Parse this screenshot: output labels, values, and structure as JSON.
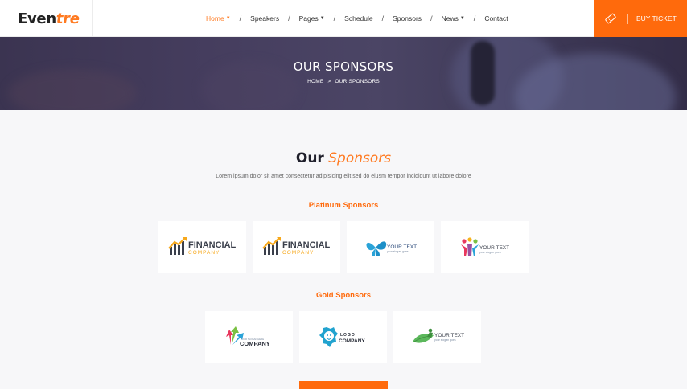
{
  "header": {
    "logo": {
      "part1": "Even",
      "part2": "tre"
    },
    "nav": [
      {
        "label": "Home",
        "dropdown": true,
        "active": true
      },
      {
        "label": "Speakers",
        "dropdown": false,
        "active": false
      },
      {
        "label": "Pages",
        "dropdown": true,
        "active": false
      },
      {
        "label": "Schedule",
        "dropdown": false,
        "active": false
      },
      {
        "label": "Sponsors",
        "dropdown": false,
        "active": false
      },
      {
        "label": "News",
        "dropdown": true,
        "active": false
      },
      {
        "label": "Contact",
        "dropdown": false,
        "active": false
      }
    ],
    "buy_ticket_label": "BUY TICKET",
    "ticket_icon": "ticket-icon"
  },
  "hero": {
    "title": "OUR SPONSORS",
    "breadcrumb": {
      "home": "HOME",
      "separator": ">",
      "current": "OUR SPONSORS"
    }
  },
  "section": {
    "title_dark": "Our",
    "title_accent": "Sponsors",
    "subtitle": "Lorem ipsum dolor sit amet consectetur adipisicing elit sed do eiusm tempor incididunt ut labore dolore"
  },
  "platinum": {
    "label": "Platinum Sponsors",
    "logos": [
      {
        "kind": "financial",
        "line1": "FINANCIAL",
        "line2": "COMPANY"
      },
      {
        "kind": "financial",
        "line1": "FINANCIAL",
        "line2": "COMPANY"
      },
      {
        "kind": "butterfly",
        "line1": "YOUR TEXT",
        "line2": "your slogan goes"
      },
      {
        "kind": "people",
        "line1": "YOUR TEXT",
        "line2": "your slogan goes"
      }
    ]
  },
  "gold": {
    "label": "Gold Sponsors",
    "logos": [
      {
        "kind": "arrows",
        "line1": "YOUR SLOGAN HERE",
        "line2": "COMPANY"
      },
      {
        "kind": "lion",
        "line1": "LOGO",
        "line2": "COMPANY"
      },
      {
        "kind": "leaf",
        "line1": "YOUR TEXT",
        "line2": "your slogan goes"
      }
    ]
  },
  "colors": {
    "accent": "#ff6a0c",
    "accent_text": "#ff7a21",
    "hero_bg": "#433c5c",
    "page_bg": "#f7f7f9"
  }
}
